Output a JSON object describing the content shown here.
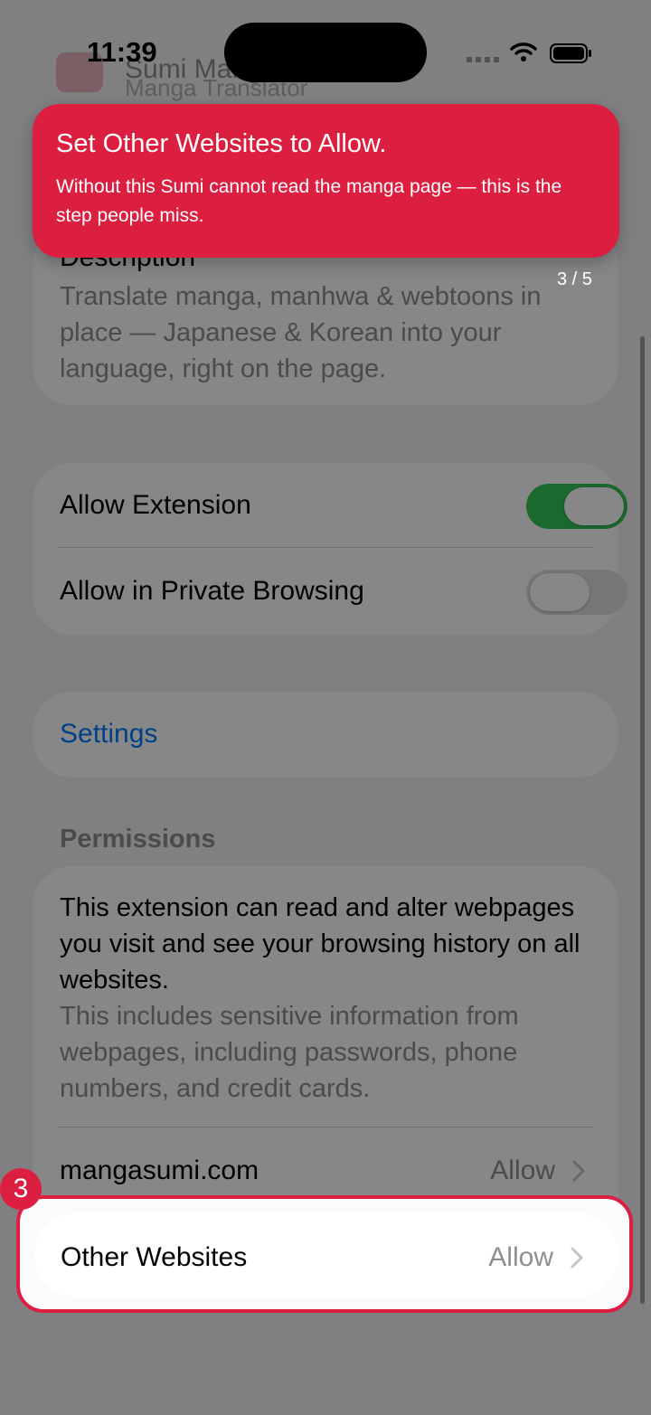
{
  "status_bar": {
    "time": "11:39"
  },
  "header": {
    "title": "Sumi Manga",
    "subtitle": "Manga Translator"
  },
  "description": {
    "label": "Description",
    "text": "Translate manga, manhwa & webtoons in place — Japanese & Korean into your language, right on the page."
  },
  "toggles": {
    "allow_extension": {
      "label": "Allow Extension",
      "state": "on"
    },
    "private_browsing": {
      "label": "Allow in Private Browsing",
      "state": "off"
    }
  },
  "settings_link": "Settings",
  "permissions": {
    "header": "Permissions",
    "main_text": "This extension can read and alter webpages you visit and see your browsing history on all websites.",
    "detail_text": "This includes sensitive information from webpages, including passwords, phone numbers, and credit cards.",
    "sites": [
      {
        "name": "mangasumi.com",
        "value": "Allow"
      },
      {
        "name": "Other Websites",
        "value": "Allow"
      }
    ]
  },
  "coach": {
    "title": "Set Other Websites to Allow.",
    "body": "Without this Sumi cannot read the manga page — this is the step people miss.",
    "step_number": "3",
    "progress": "3 / 5",
    "accent_color": "#dc1e40"
  }
}
